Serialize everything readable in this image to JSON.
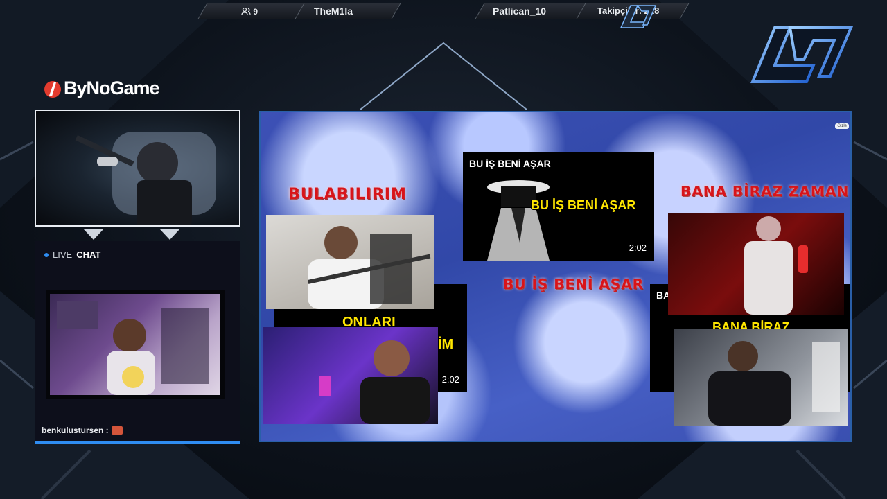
{
  "topbar": {
    "viewers_icon": "users-icon",
    "viewers": "9",
    "player_left": "TheM1la",
    "player_right": "Patlican_10",
    "followers": "Takipçiler: 218"
  },
  "sponsor": {
    "name": "ByNoGame"
  },
  "chat": {
    "live": "LIVE",
    "chat": "CHAT",
    "message_user": "benkulustursen :"
  },
  "main": {
    "hide_label": "Gizle",
    "labels": {
      "left": "BULABILIRIM",
      "center": "BU İŞ BENİ AŞAR",
      "right": "BANA BİRAZ ZAMAN VER"
    },
    "card_top": {
      "title": "BU İŞ BENİ AŞAR",
      "caption": "BU İŞ BENİ AŞAR",
      "time": "2:02"
    },
    "card_left": {
      "caption_a": "ONLARI",
      "caption_b": "İM",
      "time": "2:02"
    },
    "card_right": {
      "title": "BA",
      "caption": "BANA BİRAZ"
    }
  },
  "colors": {
    "accent_blue": "#2f8df2",
    "red_text": "#d8141a",
    "yellow_caption": "#ffe600"
  }
}
